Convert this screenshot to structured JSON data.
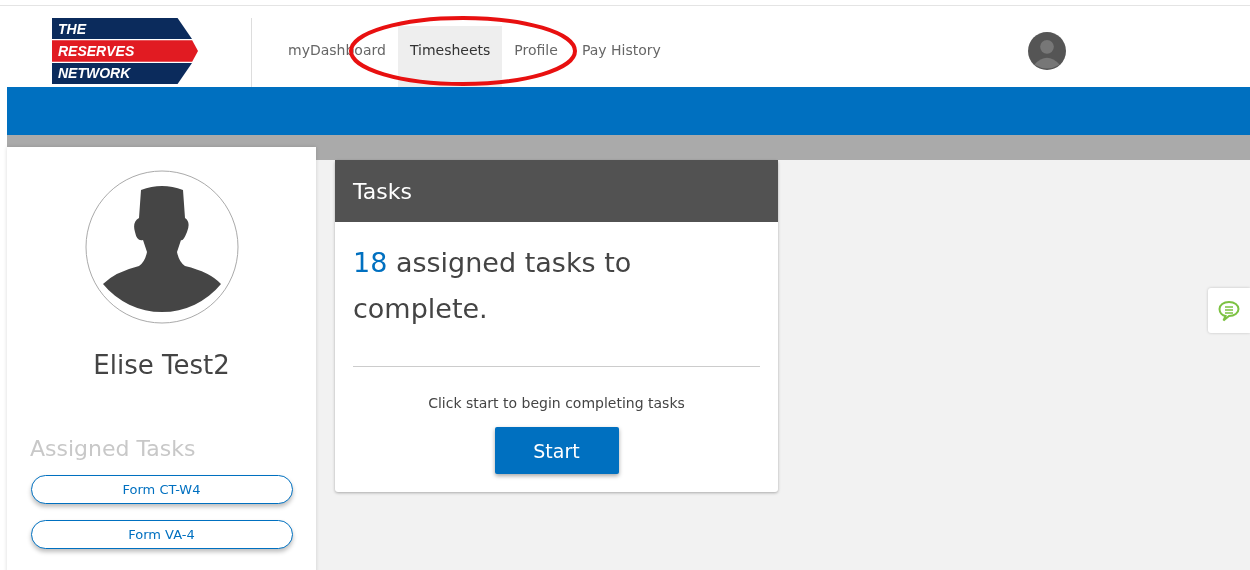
{
  "logo": {
    "lines": [
      "THE",
      "RESERVES",
      "NETWORK"
    ]
  },
  "nav": [
    {
      "label": "myDashboard",
      "selected": false
    },
    {
      "label": "Timesheets",
      "selected": true
    },
    {
      "label": "Profile",
      "selected": false
    },
    {
      "label": "Pay History",
      "selected": false
    }
  ],
  "profile": {
    "name": "Elise Test2"
  },
  "assigned_tasks": {
    "title": "Assigned Tasks",
    "items": [
      "Form CT-W4",
      "Form VA-4"
    ]
  },
  "tasks_card": {
    "title": "Tasks",
    "count": "18",
    "message": "assigned tasks to complete.",
    "hint": "Click start to begin completing tasks",
    "button": "Start"
  },
  "annotations": [
    {
      "kind": "ellipse",
      "color": "#e81010"
    }
  ]
}
